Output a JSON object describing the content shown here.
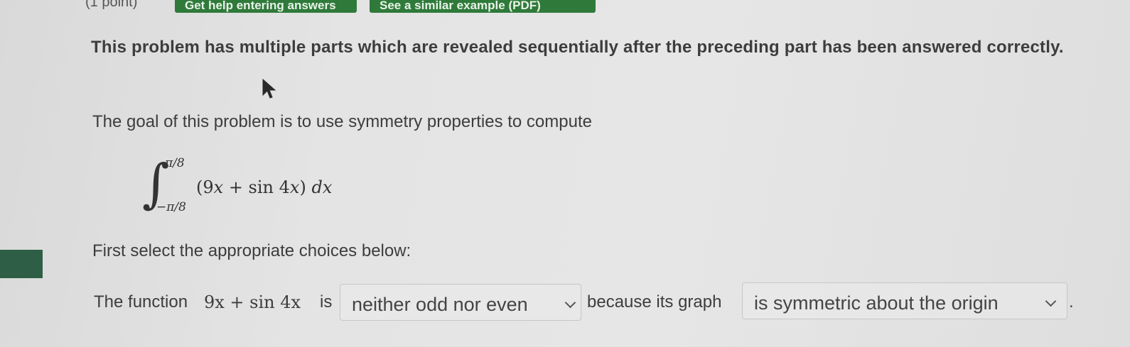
{
  "top_bar": {
    "points_label": "(1 point)",
    "help_button_label": "Get help entering answers",
    "example_button_label": "See a similar example (PDF)"
  },
  "problem": {
    "intro": "This problem has multiple parts which are revealed sequentially after the preceding part has been answered correctly.",
    "goal": "The goal of this problem is to use symmetry properties to compute",
    "integral": {
      "upper_limit": "π/8",
      "lower_limit": "−π/8",
      "integrand_open": "(9",
      "integrand_var": "x",
      "integrand_mid": " + sin 4",
      "integrand_var2": "x",
      "integrand_close": ") ",
      "differential": "dx"
    },
    "instruction": "First select the appropriate choices below:"
  },
  "answer": {
    "prefix": "The function",
    "function_expr": "9x + sin 4x",
    "is_text": "is",
    "parity_select": {
      "selected": "neither odd nor even"
    },
    "because_text": "because its graph",
    "symmetry_select": {
      "selected": "is symmetric about the origin"
    },
    "end_punct": "."
  },
  "icons": {
    "cursor": "mouse-pointer-icon",
    "chevron": "chevron-down-icon"
  },
  "colors": {
    "button_green": "#2f7a3a",
    "side_block": "#2f5e46"
  }
}
